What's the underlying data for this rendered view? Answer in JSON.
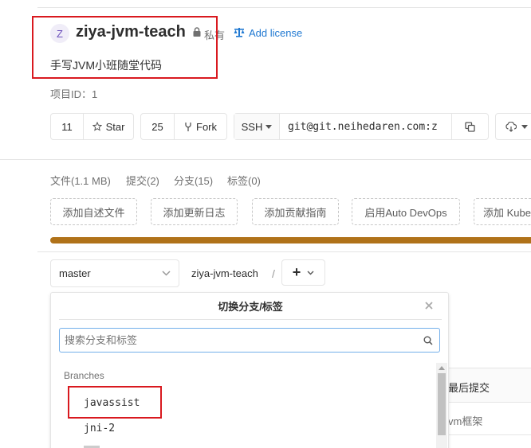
{
  "project": {
    "avatar_letter": "Z",
    "name": "ziya-jvm-teach",
    "visibility": "私有",
    "license_link": "Add license",
    "description": "手写JVM小班随堂代码",
    "project_id": "项目ID：1"
  },
  "actions": {
    "star_count": "11",
    "star_label": "Star",
    "fork_count": "25",
    "fork_label": "Fork",
    "clone_protocol": "SSH",
    "clone_url": "git@git.neihedaren.com:z"
  },
  "stats": {
    "files": "文件(1.1 MB)",
    "commits": "提交(2)",
    "branches": "分支(15)",
    "tags": "标签(0)"
  },
  "quick_add": [
    "添加自述文件",
    "添加更新日志",
    "添加贡献指南",
    "启用Auto DevOps",
    "添加 Kube"
  ],
  "repo_nav": {
    "branch": "master",
    "path": "ziya-jvm-teach",
    "separator": "/",
    "add": "+"
  },
  "dropdown": {
    "title": "切换分支/标签",
    "search_placeholder": "搜索分支和标签",
    "section": "Branches",
    "items": [
      "javassist",
      "jni-2"
    ]
  },
  "table": {
    "last_commit_header": "最后提交",
    "row_text": "vm框架"
  },
  "colors": {
    "accent": "#1f78d1",
    "language_bar": "#b07219",
    "highlight": "#d9191f"
  }
}
